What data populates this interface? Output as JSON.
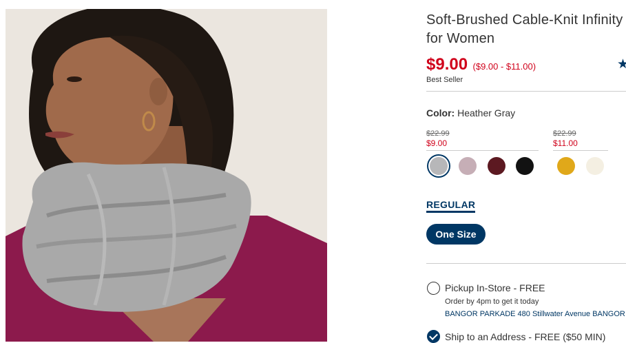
{
  "product": {
    "title_line1": "Soft-Brushed Cable-Knit Infinity",
    "title_line2": "for Women",
    "price": "$9.00",
    "price_range": "($9.00 - $11.00)",
    "badge": "Best Seller",
    "rating_icon": "star-icon",
    "image_icon": "product-photo"
  },
  "color": {
    "label": "Color:",
    "value": "Heather Gray",
    "price_groups": [
      {
        "original": "$22.99",
        "sale": "$9.00"
      },
      {
        "original": "$22.99",
        "sale": "$11.00"
      }
    ],
    "swatches": [
      {
        "name": "heather-gray",
        "color": "#b7b7b9",
        "selected": true
      },
      {
        "name": "mauve",
        "color": "#c6aeb6",
        "selected": false
      },
      {
        "name": "burgundy",
        "color": "#5c1921",
        "selected": false
      },
      {
        "name": "black",
        "color": "#121212",
        "selected": false
      },
      {
        "name": "mustard",
        "color": "#e0a81a",
        "selected": false
      },
      {
        "name": "cream",
        "color": "#f4efe2",
        "selected": false
      }
    ]
  },
  "fit": {
    "tab_label": "REGULAR"
  },
  "size": {
    "option": "One Size"
  },
  "fulfillment": {
    "pickup_label": "Pickup In-Store - FREE",
    "pickup_sub": "Order by 4pm to get it today",
    "pickup_store": "BANGOR PARKADE 480 Stillwater Avenue  BANGOR",
    "ship_label": "Ship to an Address - FREE ($50 MIN)"
  },
  "colors": {
    "brand_navy": "#003764",
    "sale_red": "#d0021b"
  }
}
